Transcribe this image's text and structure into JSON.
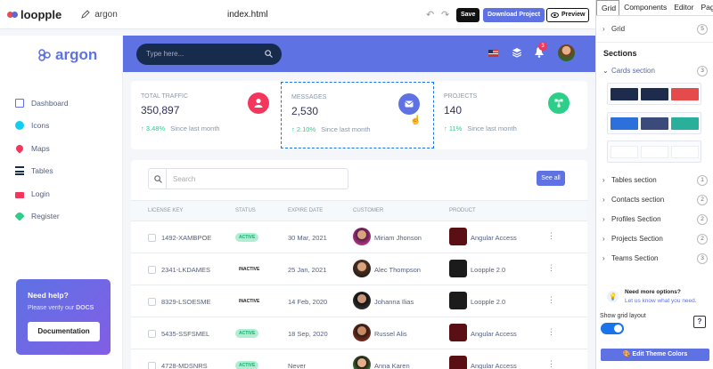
{
  "app": {
    "brand": "loopple",
    "project": "argon",
    "file": "index.html"
  },
  "toolbar": {
    "save": "Save",
    "download": "Download Project",
    "preview": "Preview"
  },
  "sidebar": {
    "brand": "argon",
    "items": [
      {
        "label": "Dashboard",
        "icon": "monitor-icon",
        "color": "#5e72e4"
      },
      {
        "label": "Icons",
        "icon": "planet-icon",
        "color": "#11cdef"
      },
      {
        "label": "Maps",
        "icon": "pin-icon",
        "color": "#f5365c"
      },
      {
        "label": "Tables",
        "icon": "bullet-list-icon",
        "color": "#172b4d"
      },
      {
        "label": "Login",
        "icon": "lock-icon",
        "color": "#f5365c"
      },
      {
        "label": "Register",
        "icon": "key-icon",
        "color": "#2dce89"
      }
    ],
    "help": {
      "title": "Need help?",
      "text": "Please verify our",
      "link": "DOCS",
      "button": "Documentation"
    }
  },
  "header": {
    "search_placeholder": "Type here...",
    "notification_count": "3"
  },
  "stats": [
    {
      "label": "TOTAL TRAFFIC",
      "value": "350,897",
      "change": "3.48%",
      "since": "Since last month",
      "color": "#f5365c"
    },
    {
      "label": "MESSAGES",
      "value": "2,530",
      "change": "2.10%",
      "since": "Since last month",
      "color": "#5e72e4"
    },
    {
      "label": "PROJECTS",
      "value": "140",
      "change": "11%",
      "since": "Since last month",
      "color": "#2dce89"
    }
  ],
  "table": {
    "search_placeholder": "Search",
    "see_all": "See all",
    "headers": [
      "LICENSE KEY",
      "STATUS",
      "EXPIRE DATE",
      "CUSTOMER",
      "PRODUCT"
    ],
    "rows": [
      {
        "key": "1492-XAMBPOE",
        "status": "ACTIVE",
        "expire": "30 Mar, 2021",
        "customer": "Miriam Jhonson",
        "product": "Angular Access"
      },
      {
        "key": "2341-LKDAMES",
        "status": "INACTIVE",
        "expire": "25 Jan, 2021",
        "customer": "Alec Thompson",
        "product": "Loopple 2.0"
      },
      {
        "key": "8329-LSOESME",
        "status": "INACTIVE",
        "expire": "14 Feb, 2020",
        "customer": "Johanna Ilias",
        "product": "Loopple 2.0"
      },
      {
        "key": "5435-SSFSMEL",
        "status": "ACTIVE",
        "expire": "18 Sep, 2020",
        "customer": "Russel Alis",
        "product": "Angular Access"
      },
      {
        "key": "4728-MDSNRS",
        "status": "ACTIVE",
        "expire": "Never",
        "customer": "Anna Karen",
        "product": "Angular Access"
      }
    ]
  },
  "panel": {
    "tabs": [
      "Grid",
      "Components",
      "Editor",
      "Pages"
    ],
    "grid": {
      "label": "Grid",
      "count": "5"
    },
    "sections_title": "Sections",
    "cards": {
      "label": "Cards section",
      "count": "3"
    },
    "list": [
      {
        "label": "Tables section",
        "count": "1"
      },
      {
        "label": "Contacts section",
        "count": "2"
      },
      {
        "label": "Profiles Section",
        "count": "2"
      },
      {
        "label": "Projects Section",
        "count": "2"
      },
      {
        "label": "Teams Section",
        "count": "3"
      }
    ],
    "more_title": "Need more options?",
    "more_link": "Let us know what you need.",
    "grid_layout": "Show grid layout",
    "theme_button": "Edit Theme Colors"
  }
}
